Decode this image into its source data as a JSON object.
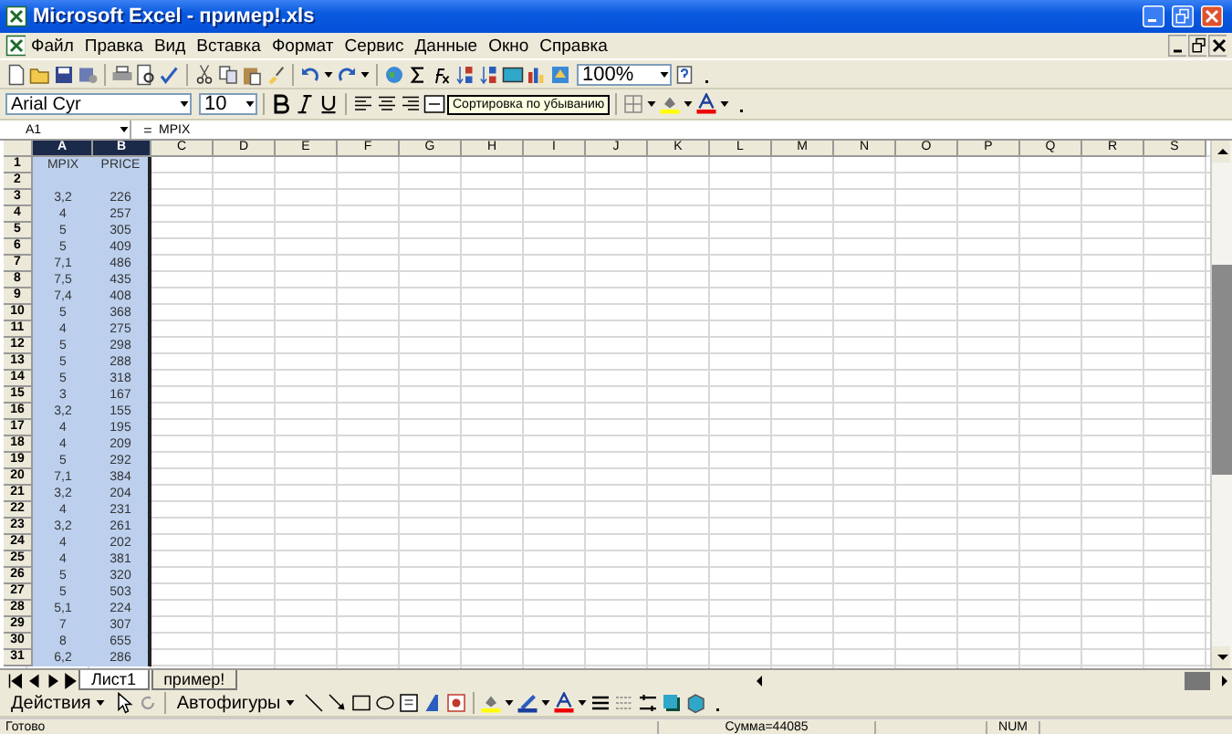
{
  "window": {
    "title": "Microsoft Excel - пример!.xls"
  },
  "menu": [
    "Файл",
    "Правка",
    "Вид",
    "Вставка",
    "Формат",
    "Сервис",
    "Данные",
    "Окно",
    "Справка"
  ],
  "standard_toolbar": {
    "zoom": "100%"
  },
  "format_toolbar": {
    "font": "Arial Cyr",
    "size": "10"
  },
  "tooltip": "Сортировка по убыванию",
  "formula_bar": {
    "name_box": "A1",
    "equals": "=",
    "formula": "MPIX"
  },
  "sheet": {
    "columns": [
      {
        "label": "A",
        "selected": true
      },
      {
        "label": "B",
        "selected": true
      },
      {
        "label": "C",
        "selected": false
      },
      {
        "label": "D",
        "selected": false
      },
      {
        "label": "E",
        "selected": false
      },
      {
        "label": "F",
        "selected": false
      },
      {
        "label": "G",
        "selected": false
      },
      {
        "label": "H",
        "selected": false
      },
      {
        "label": "I",
        "selected": false
      },
      {
        "label": "J",
        "selected": false
      },
      {
        "label": "K",
        "selected": false
      },
      {
        "label": "L",
        "selected": false
      },
      {
        "label": "M",
        "selected": false
      },
      {
        "label": "N",
        "selected": false
      },
      {
        "label": "O",
        "selected": false
      },
      {
        "label": "P",
        "selected": false
      },
      {
        "label": "Q",
        "selected": false
      },
      {
        "label": "R",
        "selected": false
      },
      {
        "label": "S",
        "selected": false
      }
    ],
    "rows": [
      {
        "number": "1",
        "cells": [
          "MPIX",
          "PRICE"
        ]
      },
      {
        "number": "2"
      },
      {
        "number": "3",
        "cells": [
          "3,2",
          "226"
        ]
      },
      {
        "number": "4",
        "cells": [
          "4",
          "257"
        ]
      },
      {
        "number": "5",
        "cells": [
          "5",
          "305"
        ]
      },
      {
        "number": "6",
        "cells": [
          "5",
          "409"
        ]
      },
      {
        "number": "7",
        "cells": [
          "7,1",
          "486"
        ]
      },
      {
        "number": "8",
        "cells": [
          "7,5",
          "435"
        ]
      },
      {
        "number": "9",
        "cells": [
          "7,4",
          "408"
        ]
      },
      {
        "number": "10",
        "cells": [
          "5",
          "368"
        ]
      },
      {
        "number": "11",
        "cells": [
          "4",
          "275"
        ]
      },
      {
        "number": "12",
        "cells": [
          "5",
          "298"
        ]
      },
      {
        "number": "13",
        "cells": [
          "5",
          "288"
        ]
      },
      {
        "number": "14",
        "cells": [
          "5",
          "318"
        ]
      },
      {
        "number": "15",
        "cells": [
          "3",
          "167"
        ]
      },
      {
        "number": "16",
        "cells": [
          "3,2",
          "155"
        ]
      },
      {
        "number": "17",
        "cells": [
          "4",
          "195"
        ]
      },
      {
        "number": "18",
        "cells": [
          "4",
          "209"
        ]
      },
      {
        "number": "19",
        "cells": [
          "5",
          "292"
        ]
      },
      {
        "number": "20",
        "cells": [
          "7,1",
          "384"
        ]
      },
      {
        "number": "21",
        "cells": [
          "3,2",
          "204"
        ]
      },
      {
        "number": "22",
        "cells": [
          "4",
          "231"
        ]
      },
      {
        "number": "23",
        "cells": [
          "3,2",
          "261"
        ]
      },
      {
        "number": "24",
        "cells": [
          "4",
          "202"
        ]
      },
      {
        "number": "25",
        "cells": [
          "4",
          "381"
        ]
      },
      {
        "number": "26",
        "cells": [
          "5",
          "320"
        ]
      },
      {
        "number": "27",
        "cells": [
          "5",
          "503"
        ]
      },
      {
        "number": "28",
        "cells": [
          "5,1",
          "224"
        ]
      },
      {
        "number": "29",
        "cells": [
          "7",
          "307"
        ]
      },
      {
        "number": "30",
        "cells": [
          "8",
          "655"
        ]
      },
      {
        "number": "31",
        "cells": [
          "6,2",
          "286"
        ]
      }
    ]
  },
  "sheet_tabs": [
    {
      "label": "Лист1",
      "selected": true
    },
    {
      "label": "пример!",
      "selected": false
    }
  ],
  "drawing_toolbar": {
    "actions": "Действия",
    "autoshapes": "Автофигуры"
  },
  "status_bar": {
    "status": "Готово",
    "sum": "Сумма=44085",
    "num": "NUM"
  }
}
